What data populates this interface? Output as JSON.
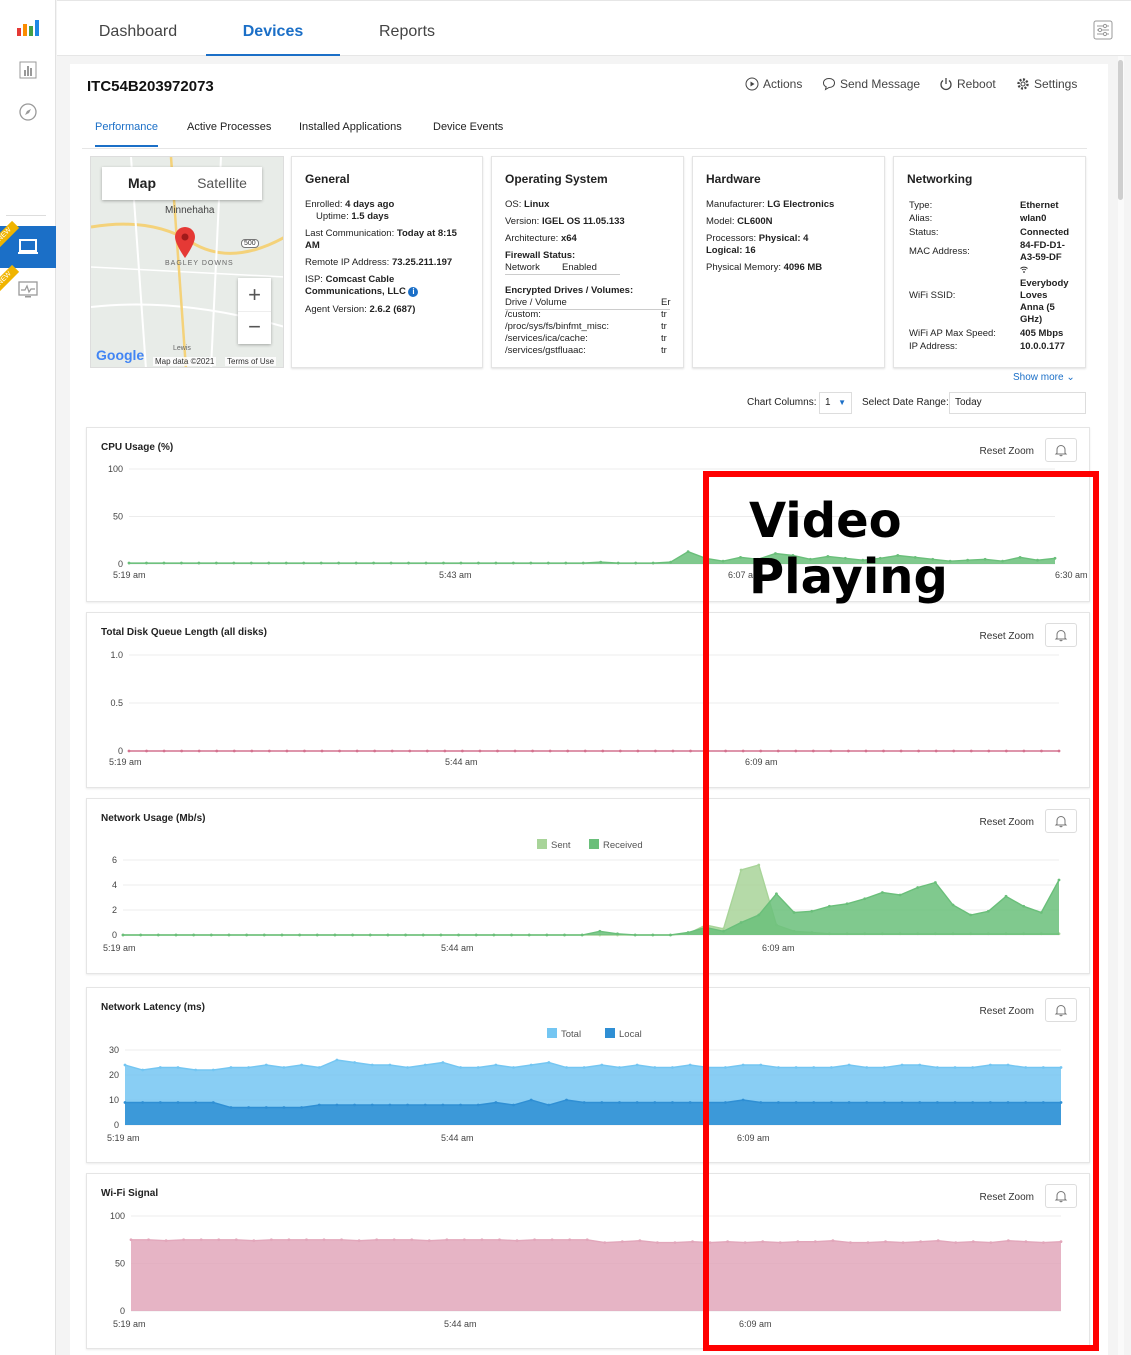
{
  "nav": {
    "tabs": [
      {
        "label": "Dashboard"
      },
      {
        "label": "Devices"
      },
      {
        "label": "Reports"
      }
    ],
    "active_tab": "Devices",
    "rail_new_badge": "NEW"
  },
  "device": {
    "id": "ITC54B203972073",
    "actions": [
      {
        "label": "Actions"
      },
      {
        "label": "Send Message"
      },
      {
        "label": "Reboot"
      },
      {
        "label": "Settings"
      }
    ],
    "subtabs": [
      {
        "label": "Performance"
      },
      {
        "label": "Active Processes"
      },
      {
        "label": "Installed Applications"
      },
      {
        "label": "Device Events"
      }
    ]
  },
  "map": {
    "toggle": [
      "Map",
      "Satellite"
    ],
    "place_top": "Minnehaha",
    "place_mid": "BAGLEY DOWNS",
    "road": "500",
    "place_bottom": "Lewis",
    "attribution": "Map data ©2021",
    "terms": "Terms of Use",
    "logo": "Google"
  },
  "general": {
    "title": "General",
    "enrolled_label": "Enrolled:",
    "enrolled": "4 days ago",
    "uptime_label": "Uptime:",
    "uptime": "1.5 days",
    "lastcomm_label": "Last Communication:",
    "lastcomm": "Today at 8:15",
    "lastcomm2": "AM",
    "remoteip_label": "Remote IP Address:",
    "remoteip": "73.25.211.197",
    "isp_label": "ISP:",
    "isp": "Comcast Cable",
    "isp2": "Communications, LLC",
    "agent_label": "Agent Version:",
    "agent": "2.6.2 (687)"
  },
  "os": {
    "title": "Operating System",
    "os_label": "OS:",
    "os": "Linux",
    "version_label": "Version:",
    "version": "IGEL OS 11.05.133",
    "arch_label": "Architecture:",
    "arch": "x64",
    "fw_label": "Firewall Status:",
    "fw_col1": "Network",
    "fw_col2": "Enabled",
    "enc_label": "Encrypted Drives / Volumes:",
    "enc_header": "Drive / Volume",
    "enc_header2": "Er",
    "drives": [
      {
        "name": "/custom:",
        "val": "tr"
      },
      {
        "name": "/proc/sys/fs/binfmt_misc:",
        "val": "tr"
      },
      {
        "name": "/services/ica/cache:",
        "val": "tr"
      },
      {
        "name": "/services/gstfluaac:",
        "val": "tr"
      }
    ]
  },
  "hardware": {
    "title": "Hardware",
    "mfr_label": "Manufacturer:",
    "mfr": "LG Electronics",
    "model_label": "Model:",
    "model": "CL600N",
    "proc_label": "Processors:",
    "proc": "Physical: 4",
    "proc2": "Logical: 16",
    "mem_label": "Physical Memory:",
    "mem": "4096 MB"
  },
  "networking": {
    "title": "Networking",
    "type_label": "Type:",
    "type": "Ethernet",
    "alias_label": "Alias:",
    "alias": "wlan0",
    "status_label": "Status:",
    "status": "Connected",
    "mac_label": "MAC Address:",
    "mac1": "84-FD-D1-",
    "mac2": "A3-59-DF",
    "ssid_label": "WiFi SSID:",
    "ssid1": "Everybody",
    "ssid2": "Loves",
    "ssid3": "Anna (5",
    "ssid4": "GHz)",
    "speed_label": "WiFi AP Max Speed:",
    "speed": "405 Mbps",
    "ip_label": "IP Address:",
    "ip": "10.0.0.177"
  },
  "controls": {
    "show_more": "Show more",
    "chart_columns_label": "Chart Columns:",
    "chart_columns": "1",
    "date_range_label": "Select Date Range:",
    "date_range": "Today"
  },
  "overlay": {
    "label": "Video Playing",
    "color": "#ff0000"
  },
  "reset_zoom_label": "Reset Zoom",
  "chart_data": [
    {
      "type": "area",
      "title": "CPU Usage (%)",
      "yticks": [
        "100",
        "50",
        "0"
      ],
      "ylim": [
        0,
        100
      ],
      "xticks": [
        "5:19 am",
        "5:43 am",
        "6:07 am",
        "6:30 am"
      ],
      "series": [
        {
          "color": "#6abf7a",
          "values": [
            1,
            1,
            1,
            1,
            1,
            1,
            1,
            1,
            1,
            1,
            1,
            1,
            1,
            1,
            1,
            1,
            1,
            1,
            1,
            1,
            1,
            1,
            1,
            1,
            1,
            1,
            1,
            2,
            1,
            1,
            1,
            2,
            13,
            6,
            3,
            7,
            5,
            11,
            9,
            5,
            8,
            6,
            4,
            6,
            9,
            7,
            5,
            3,
            4,
            5,
            3,
            7,
            4,
            6
          ]
        }
      ]
    },
    {
      "type": "line",
      "title": "Total Disk Queue Length (all disks)",
      "yticks": [
        "1.0",
        "0.5",
        "0"
      ],
      "ylim": [
        0,
        1
      ],
      "xticks": [
        "5:19 am",
        "5:44 am",
        "6:09 am"
      ],
      "series": [
        {
          "color": "#d4728f",
          "values": [
            0,
            0,
            0,
            0,
            0,
            0,
            0,
            0,
            0,
            0,
            0,
            0,
            0,
            0,
            0,
            0,
            0,
            0,
            0,
            0,
            0,
            0,
            0,
            0,
            0,
            0,
            0,
            0,
            0,
            0,
            0,
            0,
            0,
            0,
            0,
            0,
            0,
            0,
            0,
            0,
            0,
            0,
            0,
            0,
            0,
            0,
            0,
            0,
            0,
            0,
            0,
            0,
            0,
            0
          ]
        }
      ]
    },
    {
      "type": "area",
      "title": "Network Usage (Mb/s)",
      "yticks": [
        "6",
        "4",
        "2",
        "0"
      ],
      "ylim": [
        0,
        6
      ],
      "xticks": [
        "5:19 am",
        "5:44 am",
        "6:09 am"
      ],
      "legend": [
        {
          "name": "Sent",
          "color": "#a8d499"
        },
        {
          "name": "Received",
          "color": "#6abf7a"
        }
      ],
      "series": [
        {
          "name": "Sent",
          "color": "#a8d499",
          "values": [
            0,
            0,
            0,
            0,
            0,
            0,
            0,
            0,
            0,
            0,
            0,
            0,
            0,
            0,
            0,
            0,
            0,
            0,
            0,
            0,
            0,
            0,
            0,
            0,
            0,
            0,
            0,
            0,
            0,
            0,
            0,
            0,
            0.1,
            0.8,
            0.5,
            5.2,
            5.6,
            0.8,
            0.3,
            0.2,
            0.1,
            0.1,
            0.1,
            0.1,
            0.1,
            0.1,
            0.1,
            0.1,
            0.1,
            0.1,
            0.1,
            0.1,
            0.1,
            0.1
          ]
        },
        {
          "name": "Received",
          "color": "#6abf7a",
          "values": [
            0,
            0,
            0,
            0,
            0,
            0,
            0,
            0,
            0,
            0,
            0,
            0,
            0,
            0,
            0,
            0,
            0,
            0,
            0,
            0,
            0,
            0,
            0,
            0,
            0,
            0,
            0,
            0.3,
            0.1,
            0,
            0,
            0,
            0.2,
            0.6,
            0.3,
            1.0,
            1.6,
            3.3,
            1.8,
            1.9,
            2.3,
            2.5,
            2.9,
            3.4,
            3.2,
            3.8,
            4.2,
            2.4,
            1.6,
            1.9,
            3.1,
            2.3,
            1.8,
            4.4
          ]
        }
      ]
    },
    {
      "type": "area",
      "title": "Network Latency (ms)",
      "yticks": [
        "30",
        "20",
        "10",
        "0"
      ],
      "ylim": [
        0,
        30
      ],
      "xticks": [
        "5:19 am",
        "5:44 am",
        "6:09 am"
      ],
      "legend": [
        {
          "name": "Total",
          "color": "#74c6f2"
        },
        {
          "name": "Local",
          "color": "#2f8fd4"
        }
      ],
      "series": [
        {
          "name": "Total",
          "color": "#74c6f2",
          "values": [
            24,
            22,
            23,
            23,
            22,
            22,
            23,
            23,
            24,
            23,
            24,
            23,
            26,
            25,
            24,
            24,
            23,
            24,
            25,
            23,
            23,
            24,
            23,
            24,
            25,
            23,
            23,
            24,
            23,
            24,
            23,
            23,
            24,
            23,
            23,
            24,
            24,
            23,
            23,
            23,
            23,
            24,
            23,
            23,
            24,
            24,
            23,
            23,
            23,
            24,
            24,
            23,
            23,
            23
          ]
        },
        {
          "name": "Local",
          "color": "#2f8fd4",
          "values": [
            9,
            9,
            9,
            9,
            9,
            9,
            7,
            7,
            7,
            7,
            7,
            8,
            8,
            8,
            8,
            8,
            8,
            8,
            8,
            8,
            8,
            9,
            8,
            10,
            8,
            10,
            9,
            9,
            9,
            9,
            9,
            9,
            9,
            9,
            9,
            10,
            9,
            9,
            9,
            9,
            9,
            9,
            9,
            9,
            9,
            9,
            9,
            9,
            9,
            9,
            9,
            9,
            9,
            9
          ]
        }
      ]
    },
    {
      "type": "area",
      "title": "Wi-Fi Signal",
      "yticks": [
        "100",
        "50",
        "0"
      ],
      "ylim": [
        0,
        100
      ],
      "xticks": [
        "5:19 am",
        "5:44 am",
        "6:09 am"
      ],
      "series": [
        {
          "color": "#e2a7bb",
          "values": [
            75,
            75,
            74,
            75,
            75,
            75,
            75,
            74,
            75,
            75,
            75,
            75,
            75,
            74,
            75,
            75,
            75,
            74,
            75,
            75,
            75,
            75,
            74,
            75,
            75,
            75,
            75,
            72,
            73,
            74,
            72,
            72,
            73,
            72,
            73,
            72,
            73,
            72,
            73,
            73,
            74,
            72,
            72,
            73,
            72,
            73,
            74,
            72,
            73,
            72,
            74,
            73,
            72,
            73
          ]
        }
      ]
    }
  ]
}
